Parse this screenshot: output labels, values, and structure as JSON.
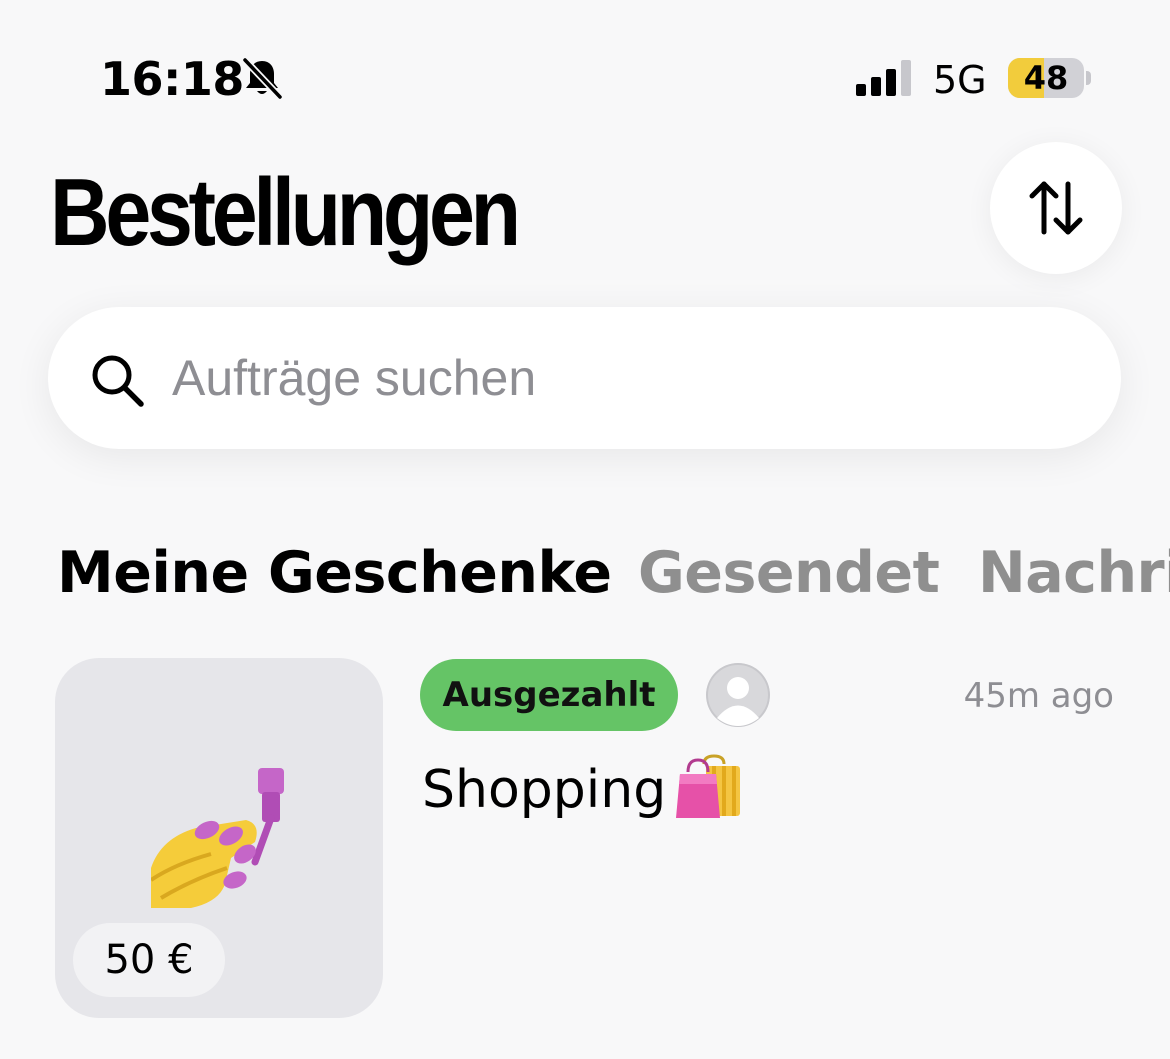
{
  "status_bar": {
    "time": "16:18",
    "network": "5G",
    "battery_level": "48",
    "battery_fraction": 0.48,
    "icons": [
      "bell-slash-icon",
      "signal-icon"
    ]
  },
  "header": {
    "title": "Bestellungen",
    "sort_icon": "sort-arrows-icon"
  },
  "search": {
    "placeholder": "Aufträge suchen",
    "icon": "search-icon"
  },
  "tabs": [
    {
      "label": "Meine Geschenke",
      "active": true
    },
    {
      "label": "Gesendet",
      "active": false
    },
    {
      "label": "Nachri",
      "active": false
    }
  ],
  "orders": [
    {
      "status": "Ausgezahlt",
      "status_color": "#65c466",
      "timestamp": "45m ago",
      "title": "Shopping",
      "title_icon": "shopping-bags-icon",
      "thumbnail_icon": "nail-polish-icon",
      "price": "50 €"
    }
  ],
  "colors": {
    "background": "#f8f8f9",
    "accent_green": "#65c466",
    "battery_yellow": "#f2cc3c",
    "inactive_tab": "#8f8f8f"
  }
}
